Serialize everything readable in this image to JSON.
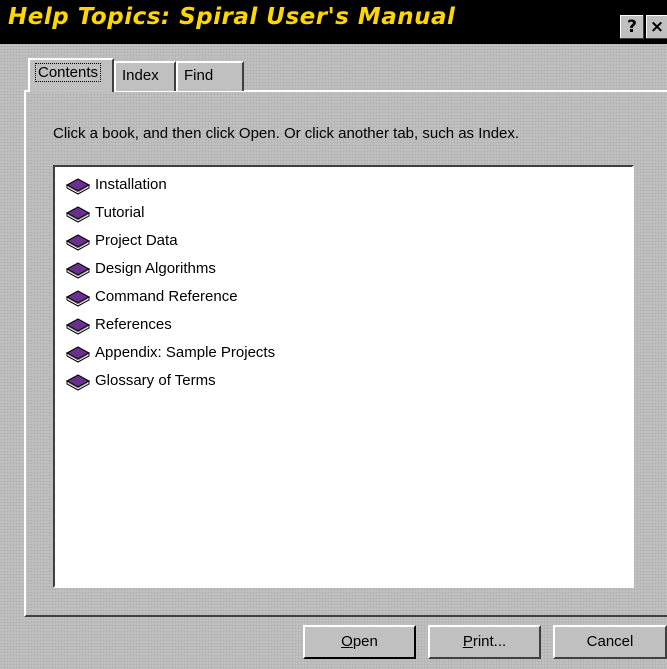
{
  "window": {
    "title": "Help Topics: Spiral User's Manual",
    "help_button": "?",
    "close_button": "×"
  },
  "tabs": [
    {
      "label": "Contents",
      "selected": true
    },
    {
      "label": "Index",
      "selected": false
    },
    {
      "label": "Find",
      "selected": false
    }
  ],
  "instruction": "Click a book, and then click Open. Or click another tab, such as Index.",
  "books": [
    {
      "label": "Installation",
      "icon": "book-icon"
    },
    {
      "label": "Tutorial",
      "icon": "book-icon"
    },
    {
      "label": "Project Data",
      "icon": "book-icon"
    },
    {
      "label": "Design Algorithms",
      "icon": "book-icon"
    },
    {
      "label": "Command Reference",
      "icon": "book-icon"
    },
    {
      "label": "References",
      "icon": "book-icon"
    },
    {
      "label": "Appendix: Sample Projects",
      "icon": "book-icon"
    },
    {
      "label": "Glossary of Terms",
      "icon": "book-icon"
    }
  ],
  "buttons": {
    "open": {
      "mnemonic": "O",
      "rest": "pen"
    },
    "print": {
      "mnemonic": "P",
      "rest": "rint..."
    },
    "cancel": {
      "label": "Cancel"
    }
  },
  "colors": {
    "title_text": "#ffd700",
    "title_bar": "#000000",
    "face": "#c0c0c0",
    "book_cover": "#6b2f8f"
  }
}
